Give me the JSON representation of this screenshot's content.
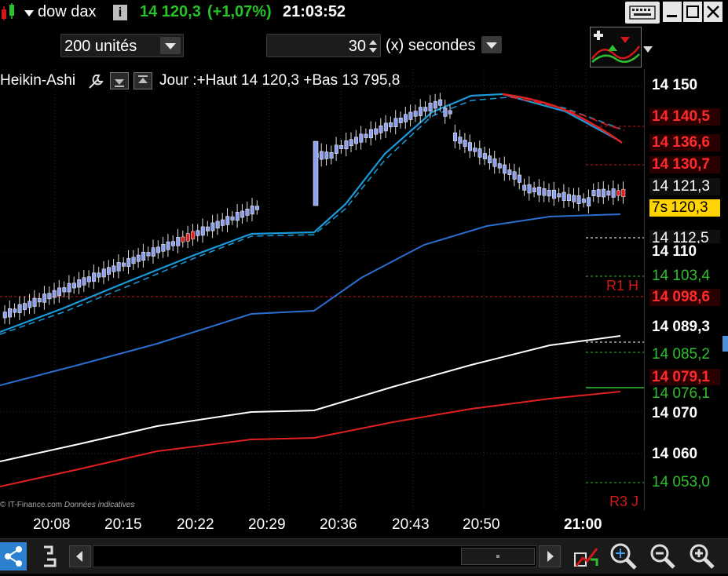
{
  "title_bar": {
    "instrument": "dow dax",
    "last_price": "14 120,3",
    "change": "(+1,07%)",
    "time": "21:03:52",
    "colors": {
      "price": "#29c229"
    }
  },
  "toolbar": {
    "units_value": "200 unités",
    "interval_value": "30",
    "interval_unit": "(x) secondes"
  },
  "chart": {
    "style_label": "Heikin-Ashi",
    "day_info": "Jour :+Haut 14 120,3 +Bas 13 795,8",
    "countdown": "7s",
    "watermark": "© IT-Finance.com",
    "watermark_note": "Données indicatives",
    "level_tags": {
      "r1": "R1 H",
      "r3": "R3 J"
    },
    "price_labels": [
      {
        "text": "14 150",
        "kind": "tick"
      },
      {
        "text": "14 140,5",
        "kind": "red"
      },
      {
        "text": "14 136,6",
        "kind": "red"
      },
      {
        "text": "14 130,7",
        "kind": "red"
      },
      {
        "text": "14 121,3",
        "kind": "dark"
      },
      {
        "text": "120,3",
        "kind": "current"
      },
      {
        "text": "14 112,5",
        "kind": "dark"
      },
      {
        "text": "14 110",
        "kind": "tick"
      },
      {
        "text": "14 103,4",
        "kind": "green"
      },
      {
        "text": "14 098,6",
        "kind": "red"
      },
      {
        "text": "14 089,3",
        "kind": "bold"
      },
      {
        "text": "14 085,2",
        "kind": "green"
      },
      {
        "text": "14 079,1",
        "kind": "red"
      },
      {
        "text": "14 076,1",
        "kind": "green"
      },
      {
        "text": "14 070",
        "kind": "tick"
      },
      {
        "text": "14 060",
        "kind": "tick"
      },
      {
        "text": "14 053,0",
        "kind": "green"
      }
    ],
    "time_labels": [
      "20:08",
      "20:15",
      "20:22",
      "20:29",
      "20:36",
      "20:43",
      "20:50",
      "21:00"
    ]
  },
  "icons": {
    "instrument": "candlestick-icon",
    "wrench": "wrench-icon",
    "keyboard": "keyboard-icon",
    "share": "share-icon",
    "zoom_fit": "zoom-fit-icon",
    "zoom_out": "zoom-out-icon",
    "zoom_in": "zoom-in-icon"
  }
}
